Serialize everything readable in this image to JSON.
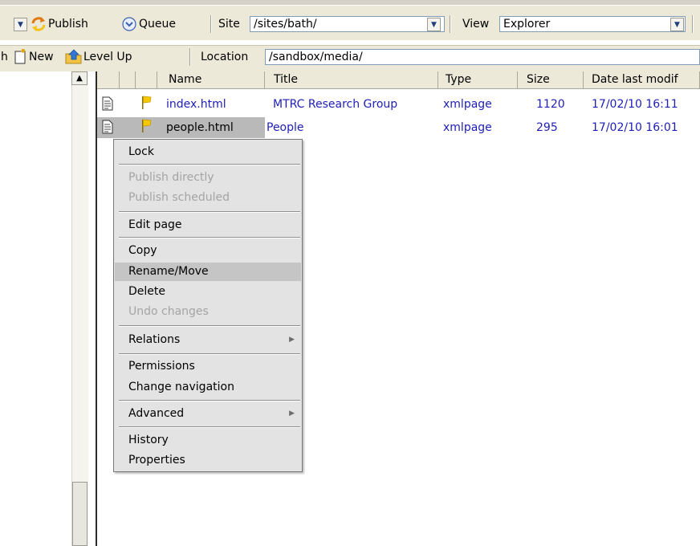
{
  "toolbar1": {
    "publish_label": "Publish",
    "queue_label": "Queue",
    "site_label": "Site",
    "site_value": "/sites/bath/",
    "view_label": "View",
    "view_value": "Explorer"
  },
  "toolbar2": {
    "cutoff_label": "h",
    "new_label": "New",
    "levelup_label": "Level Up",
    "location_label": "Location",
    "location_value": "/sandbox/media/"
  },
  "list": {
    "columns": [
      "Name",
      "Title",
      "Type",
      "Size",
      "Date last modif"
    ],
    "rows": [
      {
        "name": "index.html",
        "title": "MTRC Research Group",
        "type": "xmlpage",
        "size": "1120",
        "date": "17/02/10 16:11"
      },
      {
        "name": "people.html",
        "title": "People",
        "type": "xmlpage",
        "size": "295",
        "date": "17/02/10 16:01"
      }
    ]
  },
  "context_menu": {
    "items": [
      {
        "label": "Lock",
        "enabled": true
      },
      {
        "label": "Publish directly",
        "enabled": false
      },
      {
        "label": "Publish scheduled",
        "enabled": false
      },
      {
        "label": "Edit page",
        "enabled": true
      },
      {
        "label": "Copy",
        "enabled": true
      },
      {
        "label": "Rename/Move",
        "enabled": true,
        "highlighted": true
      },
      {
        "label": "Delete",
        "enabled": true
      },
      {
        "label": "Undo changes",
        "enabled": false
      },
      {
        "label": "Relations",
        "enabled": true,
        "submenu": true
      },
      {
        "label": "Permissions",
        "enabled": true
      },
      {
        "label": "Change navigation",
        "enabled": true
      },
      {
        "label": "Advanced",
        "enabled": true,
        "submenu": true
      },
      {
        "label": "History",
        "enabled": true
      },
      {
        "label": "Properties",
        "enabled": true
      }
    ]
  },
  "icons": {
    "publish": "publish-arrows-icon",
    "queue": "queue-chevron-icon",
    "new": "new-page-icon",
    "levelup": "folder-up-icon",
    "file": "document-icon",
    "flag": "yellow-flag-icon"
  },
  "colors": {
    "toolbar_bg": "#ece9d8",
    "link_blue": "#2020b8",
    "menu_bg": "#e3e3e3",
    "menu_highlight": "#c5c5c5",
    "selection_gray": "#b9b9b9"
  }
}
